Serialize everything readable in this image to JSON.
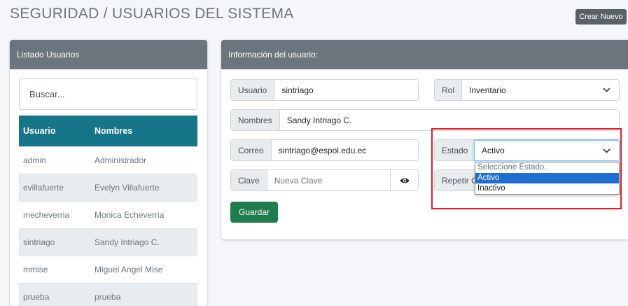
{
  "header": {
    "title": "SEGURIDAD / USUARIOS DEL SISTEMA",
    "new_button": "Crear Nuevo"
  },
  "list": {
    "title": "Listado Usuarios",
    "search_placeholder": "Buscar...",
    "columns": [
      "Usuario",
      "Nombres"
    ],
    "rows": [
      [
        "admin",
        "Administrador"
      ],
      [
        "evillafuerte",
        "Evelyn Villafuerte"
      ],
      [
        "mecheverria",
        "Monica Echeverria"
      ],
      [
        "sintriago",
        "Sandy Intriago C."
      ],
      [
        "mmise",
        "Miguel Angel Mise"
      ],
      [
        "prueba",
        "prueba"
      ]
    ]
  },
  "form": {
    "title": "Información del usuario:",
    "usuario": {
      "label": "Usuario",
      "value": "sintriago"
    },
    "rol": {
      "label": "Rol",
      "value": "Inventario"
    },
    "nombres": {
      "label": "Nombres",
      "value": "Sandy Intriago C."
    },
    "correo": {
      "label": "Correo",
      "value": "sintriago@espol.edu.ec"
    },
    "estado": {
      "label": "Estado",
      "value": "Activo",
      "options": [
        "Seleccione Estado..",
        "Activo",
        "Inactivo"
      ]
    },
    "clave": {
      "label": "Clave",
      "placeholder": "Nueva Clave"
    },
    "repetir": {
      "label": "Repetir C"
    },
    "save_button": "Guardar"
  },
  "colors": {
    "header_gray": "#6c757d",
    "table_head": "#17758a",
    "save_green": "#1e7d4a",
    "highlight_red": "#e0202a",
    "option_selected": "#1f6ed4"
  },
  "icons": [
    "eye-icon",
    "chevron-down-icon"
  ]
}
